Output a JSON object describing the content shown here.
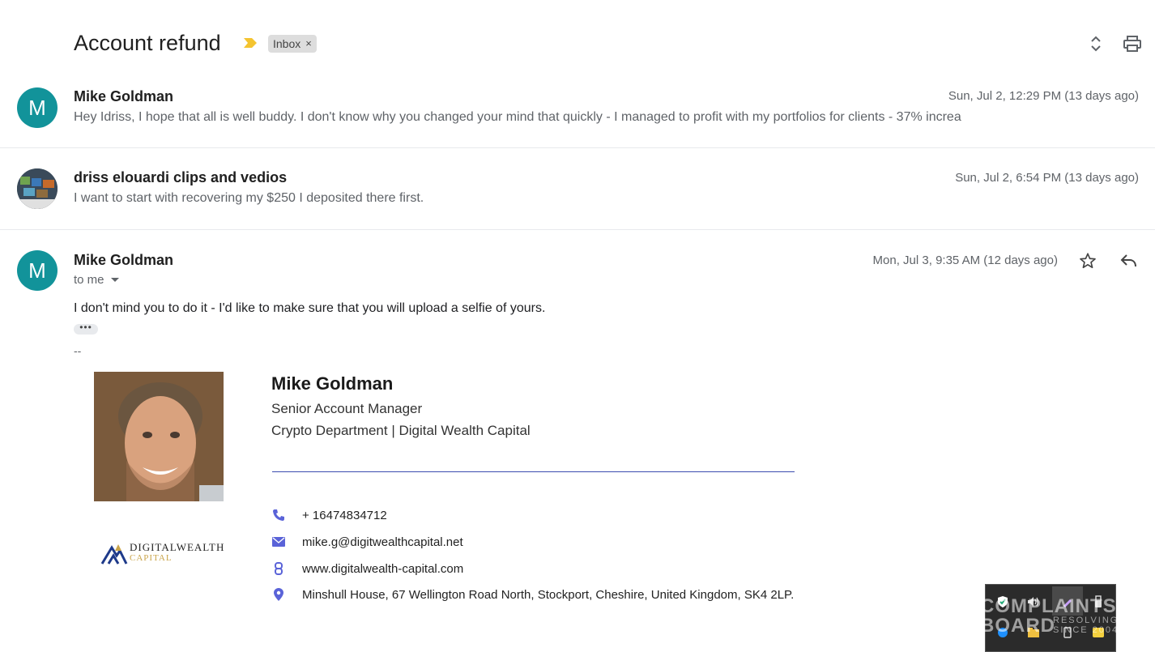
{
  "thread": {
    "subject": "Account refund",
    "label_chip": "Inbox",
    "label_remove": "×"
  },
  "messages": [
    {
      "avatar_letter": "M",
      "sender": "Mike Goldman",
      "date": "Sun, Jul 2, 12:29 PM (13 days ago)",
      "snippet": "Hey Idriss, I hope that all is well buddy. I don't know why you changed your mind that quickly - I managed to profit with my portfolios for clients - 37% increa"
    },
    {
      "avatar_letter": "",
      "sender": "driss elouardi clips and vedios",
      "date": "Sun, Jul 2, 6:54 PM (13 days ago)",
      "snippet": "I want to start with recovering my $250 I deposited there first."
    },
    {
      "avatar_letter": "M",
      "sender": "Mike Goldman",
      "date": "Mon, Jul 3, 9:35 AM (12 days ago)",
      "recipient": "to me",
      "body": "I don't mind you to do it - I'd like to make sure that you will upload a selfie of yours.",
      "trimmed": "•••",
      "sig_separator": "--"
    }
  ],
  "signature": {
    "name": "Mike Goldman",
    "title": "Senior Account Manager",
    "department": "Crypto Department  | Digital Wealth Capital",
    "phone": "+ 16474834712",
    "email": "mike.g@digitwealthcapital.net",
    "website": "www.digitalwealth-capital.com",
    "address": "Minshull House, 67 Wellington Road North, Stockport, Cheshire, United Kingdom, SK4 2LP.",
    "logo_line1": "DIGITALWEALTH",
    "logo_line2": "CAPITAL"
  },
  "watermark": {
    "line1": "COMPLAINTS",
    "line2": "BOARD",
    "sub1": "RESOLVING",
    "sub2": "SINCE 2004"
  },
  "colors": {
    "avatar": "#12939a",
    "icon_accent": "#5a63d8",
    "importance": "#f4c430"
  }
}
